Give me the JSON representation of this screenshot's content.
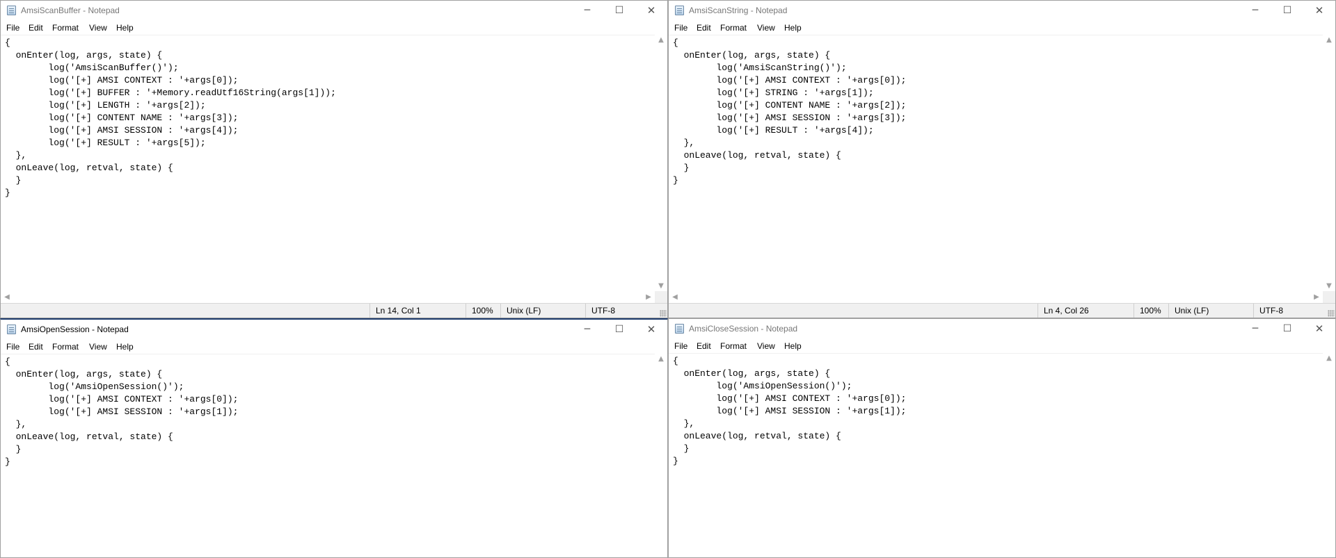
{
  "windows": [
    {
      "title": "AmsiScanBuffer - Notepad",
      "active": false,
      "has_statusbar": true,
      "menu": [
        "File",
        "Edit",
        "Format",
        "View",
        "Help"
      ],
      "code": "{\n  onEnter(log, args, state) {\n        log('AmsiScanBuffer()');\n        log('[+] AMSI CONTEXT : '+args[0]);\n        log('[+] BUFFER : '+Memory.readUtf16String(args[1]));\n        log('[+] LENGTH : '+args[2]);\n        log('[+] CONTENT NAME : '+args[3]);\n        log('[+] AMSI SESSION : '+args[4]);\n        log('[+] RESULT : '+args[5]);\n  },\n  onLeave(log, retval, state) {\n  }\n}",
      "status": {
        "position": "Ln 14, Col 1",
        "zoom": "100%",
        "line_ending": "Unix (LF)",
        "encoding": "UTF-8"
      }
    },
    {
      "title": "AmsiScanString - Notepad",
      "active": false,
      "has_statusbar": true,
      "menu": [
        "File",
        "Edit",
        "Format",
        "View",
        "Help"
      ],
      "code": "{\n  onEnter(log, args, state) {\n        log('AmsiScanString()');\n        log('[+] AMSI CONTEXT : '+args[0]);\n        log('[+] STRING : '+args[1]);\n        log('[+] CONTENT NAME : '+args[2]);\n        log('[+] AMSI SESSION : '+args[3]);\n        log('[+] RESULT : '+args[4]);\n  },\n  onLeave(log, retval, state) {\n  }\n}",
      "status": {
        "position": "Ln 4, Col 26",
        "zoom": "100%",
        "line_ending": "Unix (LF)",
        "encoding": "UTF-8"
      }
    },
    {
      "title": "AmsiOpenSession - Notepad",
      "active": true,
      "has_statusbar": false,
      "menu": [
        "File",
        "Edit",
        "Format",
        "View",
        "Help"
      ],
      "code": "{\n  onEnter(log, args, state) {\n        log('AmsiOpenSession()');\n        log('[+] AMSI CONTEXT : '+args[0]);\n        log('[+] AMSI SESSION : '+args[1]);\n  },\n  onLeave(log, retval, state) {\n  }\n}"
    },
    {
      "title": "AmsiCloseSession - Notepad",
      "active": false,
      "has_statusbar": false,
      "menu": [
        "File",
        "Edit",
        "Format",
        "View",
        "Help"
      ],
      "code": "{\n  onEnter(log, args, state) {\n        log('AmsiOpenSession()');\n        log('[+] AMSI CONTEXT : '+args[0]);\n        log('[+] AMSI SESSION : '+args[1]);\n  },\n  onLeave(log, retval, state) {\n  }\n}"
    }
  ],
  "icons": {
    "app": "notepad-icon",
    "minimize": "─",
    "maximize": "☐",
    "close": "✕",
    "scroll_up": "▲",
    "scroll_down": "▼",
    "scroll_left": "◀",
    "scroll_right": "▶"
  },
  "colors": {
    "window_bg": "#ffffff",
    "statusbar_bg": "#f0f0f0",
    "border": "#a0a0a0"
  }
}
